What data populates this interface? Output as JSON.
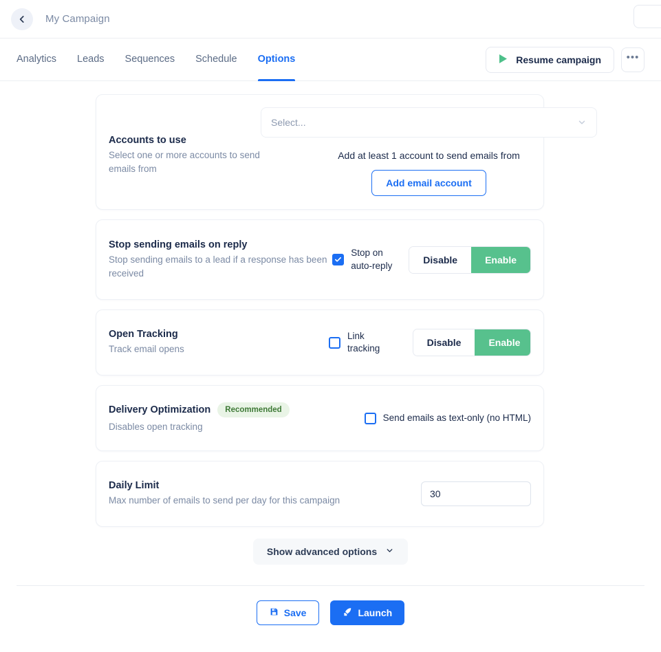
{
  "header": {
    "back_icon": "chevron-left-icon",
    "campaign_title": "My Campaign"
  },
  "tabs": [
    {
      "label": "Analytics",
      "active": false
    },
    {
      "label": "Leads",
      "active": false
    },
    {
      "label": "Sequences",
      "active": false
    },
    {
      "label": "Schedule",
      "active": false
    },
    {
      "label": "Options",
      "active": true
    }
  ],
  "tab_actions": {
    "resume_label": "Resume campaign",
    "resume_icon": "play-icon",
    "more_label": "•••",
    "more_icon": "ellipsis-icon"
  },
  "cards": {
    "accounts": {
      "title": "Accounts to use",
      "subtitle": "Select one or more accounts to send emails from",
      "select_placeholder": "Select...",
      "select_chevron_icon": "chevron-down-icon",
      "empty_message": "Add at least 1 account to send emails from",
      "add_button": "Add email account"
    },
    "stop_on_reply": {
      "title": "Stop sending emails on reply",
      "subtitle": "Stop sending emails to a lead if a response has been received",
      "checkbox_label": "Stop on auto-reply",
      "checkbox_checked": true,
      "disable_label": "Disable",
      "enable_label": "Enable",
      "state": "Enable"
    },
    "open_tracking": {
      "title": "Open Tracking",
      "subtitle": "Track email opens",
      "checkbox_label": "Link tracking",
      "checkbox_checked": false,
      "disable_label": "Disable",
      "enable_label": "Enable",
      "state": "Enable"
    },
    "delivery_optimization": {
      "title": "Delivery Optimization",
      "badge": "Recommended",
      "subtitle": "Disables open tracking",
      "checkbox_label": "Send emails as text-only (no HTML)",
      "checkbox_checked": false
    },
    "daily_limit": {
      "title": "Daily Limit",
      "subtitle": "Max number of emails to send per day for this campaign",
      "value": "30",
      "placeholder": "30"
    }
  },
  "advanced": {
    "label": "Show advanced options",
    "chevron_icon": "chevron-down-icon"
  },
  "footer": {
    "save_label": "Save",
    "save_icon": "floppy-disk-icon",
    "launch_label": "Launch",
    "launch_icon": "rocket-icon"
  },
  "colors": {
    "accent_blue": "#1b6ef3",
    "success_green": "#57c18d",
    "badge_bg": "#e9f4e6",
    "badge_text": "#3f7a37",
    "muted_text": "#7b8aa4"
  }
}
